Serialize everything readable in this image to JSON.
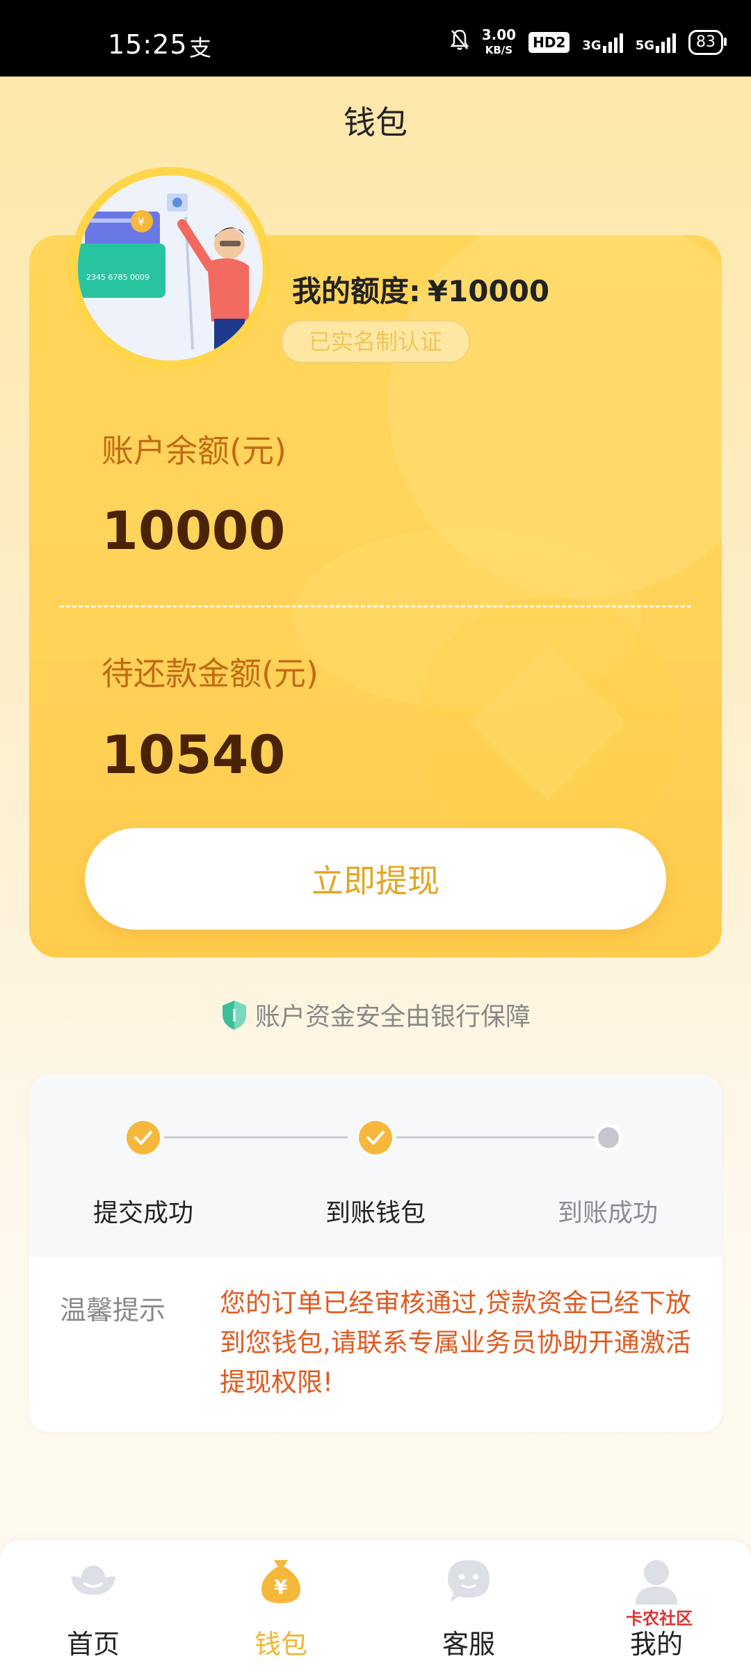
{
  "status_bar": {
    "time": "15:25",
    "net_speed_value": "3.00",
    "net_speed_unit": "KB/S",
    "hd_badge": "HD2",
    "sig1": "3G",
    "sig2": "5G",
    "battery": "83"
  },
  "header": {
    "title": "钱包"
  },
  "wallet": {
    "quota_label": "我的额度:",
    "quota_value": "¥10000",
    "verified_badge": "已实名制认证",
    "balance_label": "账户余额(元)",
    "balance_value": "10000",
    "repay_label": "待还款金额(元)",
    "repay_value": "10540",
    "withdraw_button": "立即提现",
    "security_note": "账户资金安全由银行保障"
  },
  "progress": {
    "steps": [
      {
        "label": "提交成功",
        "status": "done"
      },
      {
        "label": "到账钱包",
        "status": "done"
      },
      {
        "label": "到账成功",
        "status": "pending"
      }
    ],
    "tip_label": "温馨提示",
    "tip_text": "您的订单已经审核通过,贷款资金已经下放到您钱包,请联系专属业务员协助开通激活提现权限!"
  },
  "nav": {
    "items": [
      {
        "label": "首页",
        "icon": "ingot-icon",
        "active": false
      },
      {
        "label": "钱包",
        "icon": "money-bag-icon",
        "active": true
      },
      {
        "label": "客服",
        "icon": "chat-bubble-icon",
        "active": false
      },
      {
        "label": "我的",
        "icon": "user-icon",
        "active": false
      }
    ]
  },
  "watermark": "卡农社区",
  "colors": {
    "accent": "#f1b634",
    "card": "#ffd35a",
    "tip": "#e05a1f"
  }
}
